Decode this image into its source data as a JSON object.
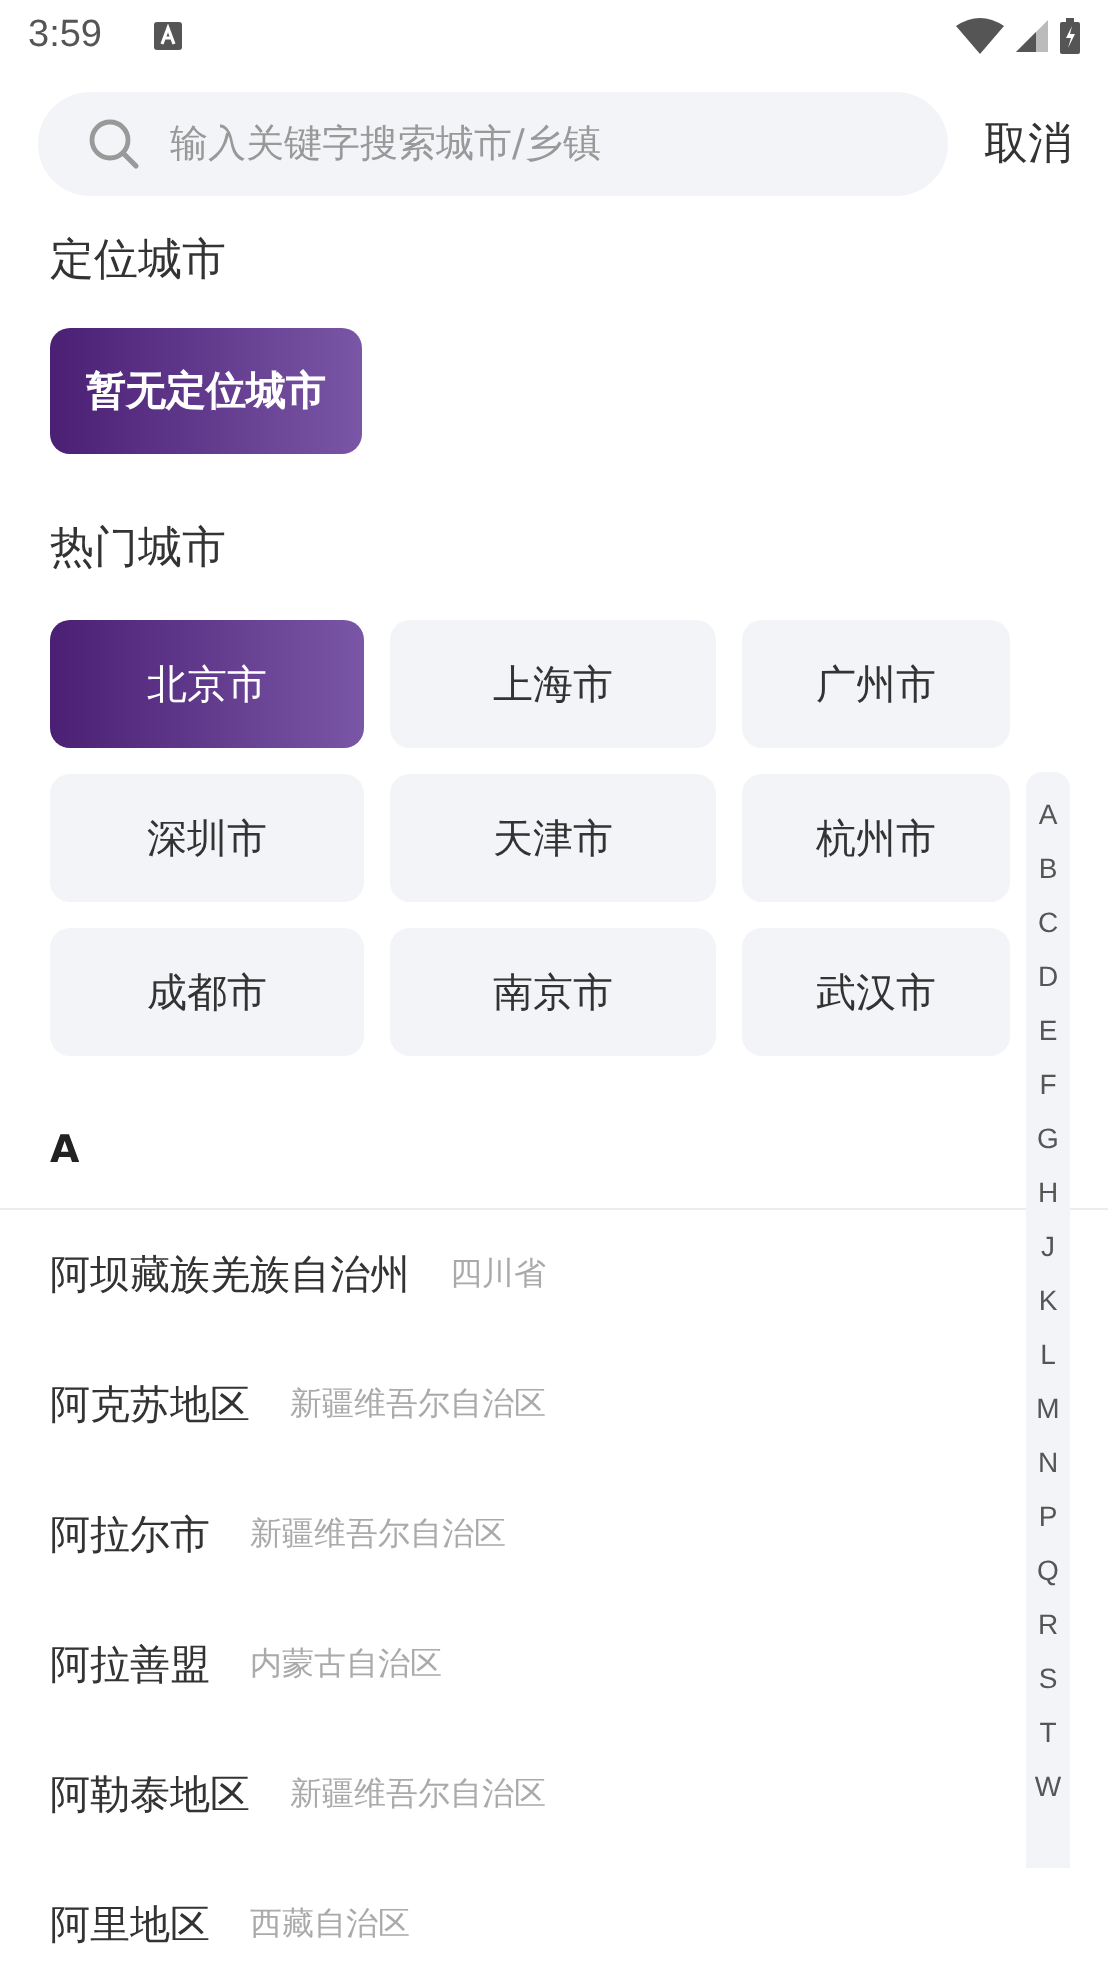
{
  "status_bar": {
    "time": "3:59"
  },
  "search": {
    "placeholder": "输入关键字搜索城市/乡镇",
    "cancel": "取消"
  },
  "location": {
    "title": "定位城市",
    "city": "暂无定位城市"
  },
  "hot": {
    "title": "热门城市",
    "cities": [
      {
        "name": "北京市",
        "selected": true
      },
      {
        "name": "上海市",
        "selected": false
      },
      {
        "name": "广州市",
        "selected": false
      },
      {
        "name": "深圳市",
        "selected": false
      },
      {
        "name": "天津市",
        "selected": false
      },
      {
        "name": "杭州市",
        "selected": false
      },
      {
        "name": "成都市",
        "selected": false
      },
      {
        "name": "南京市",
        "selected": false
      },
      {
        "name": "武汉市",
        "selected": false
      }
    ]
  },
  "section": "A",
  "cities": [
    {
      "name": "阿坝藏族羌族自治州",
      "province": "四川省"
    },
    {
      "name": "阿克苏地区",
      "province": "新疆维吾尔自治区"
    },
    {
      "name": "阿拉尔市",
      "province": "新疆维吾尔自治区"
    },
    {
      "name": "阿拉善盟",
      "province": "内蒙古自治区"
    },
    {
      "name": "阿勒泰地区",
      "province": "新疆维吾尔自治区"
    },
    {
      "name": "阿里地区",
      "province": "西藏自治区"
    }
  ],
  "index": [
    "A",
    "B",
    "C",
    "D",
    "E",
    "F",
    "G",
    "H",
    "J",
    "K",
    "L",
    "M",
    "N",
    "P",
    "Q",
    "R",
    "S",
    "T",
    "W"
  ]
}
